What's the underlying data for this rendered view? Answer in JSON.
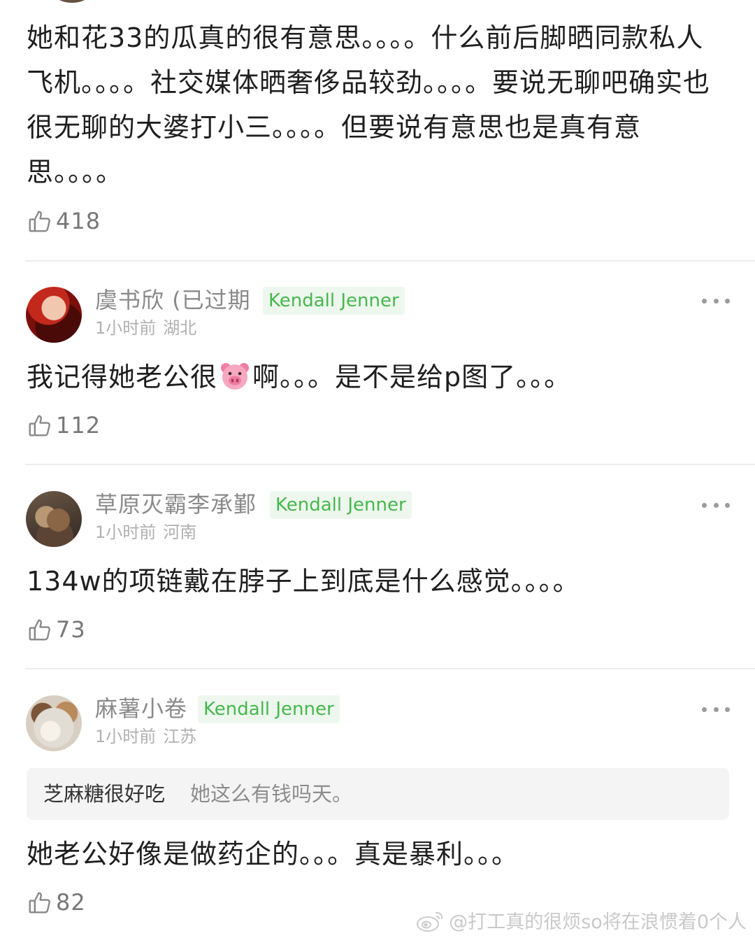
{
  "first_comment": {
    "text": "她和花33的瓜真的很有意思。。。。什么前后脚晒同款私人飞机。。。。社交媒体晒奢侈品较劲。。。。要说无聊吧确实也很无聊的大婆打小三。。。。但要说有意思也是真有意思。。。。",
    "likes": "418"
  },
  "comments": [
    {
      "username": "虞书欣 (已过期",
      "badge": "Kendall Jenner",
      "time": "1小时前",
      "location": "湖北",
      "text_before": "我记得她老公很",
      "emoji": "pig-face",
      "text_after": "啊。。。是不是给p图了。。。",
      "likes": "112"
    },
    {
      "username": "草原灭霸李承鄞",
      "badge": "Kendall Jenner",
      "time": "1小时前",
      "location": "河南",
      "text": "134w的项链戴在脖子上到底是什么感觉。。。。",
      "likes": "73"
    },
    {
      "username": "麻薯小卷",
      "badge": "Kendall Jenner",
      "time": "1小时前",
      "location": "江苏",
      "reply": {
        "author": "芝麻糖很好吃",
        "text": "她这么有钱吗天。"
      },
      "text": "她老公好像是做药企的。。。真是暴利。。。",
      "likes": "82"
    }
  ],
  "icons": {
    "like": "thumbs-up-icon",
    "more": "more-dots-icon",
    "watermark": "weibo-logo-icon"
  },
  "colors": {
    "badge_text": "#46b84d",
    "badge_bg": "#eef7ee",
    "meta": "#b0b0b0",
    "username": "#8a8a8a"
  },
  "watermark": "@打工真的很烦so将在浪惯着0个人"
}
